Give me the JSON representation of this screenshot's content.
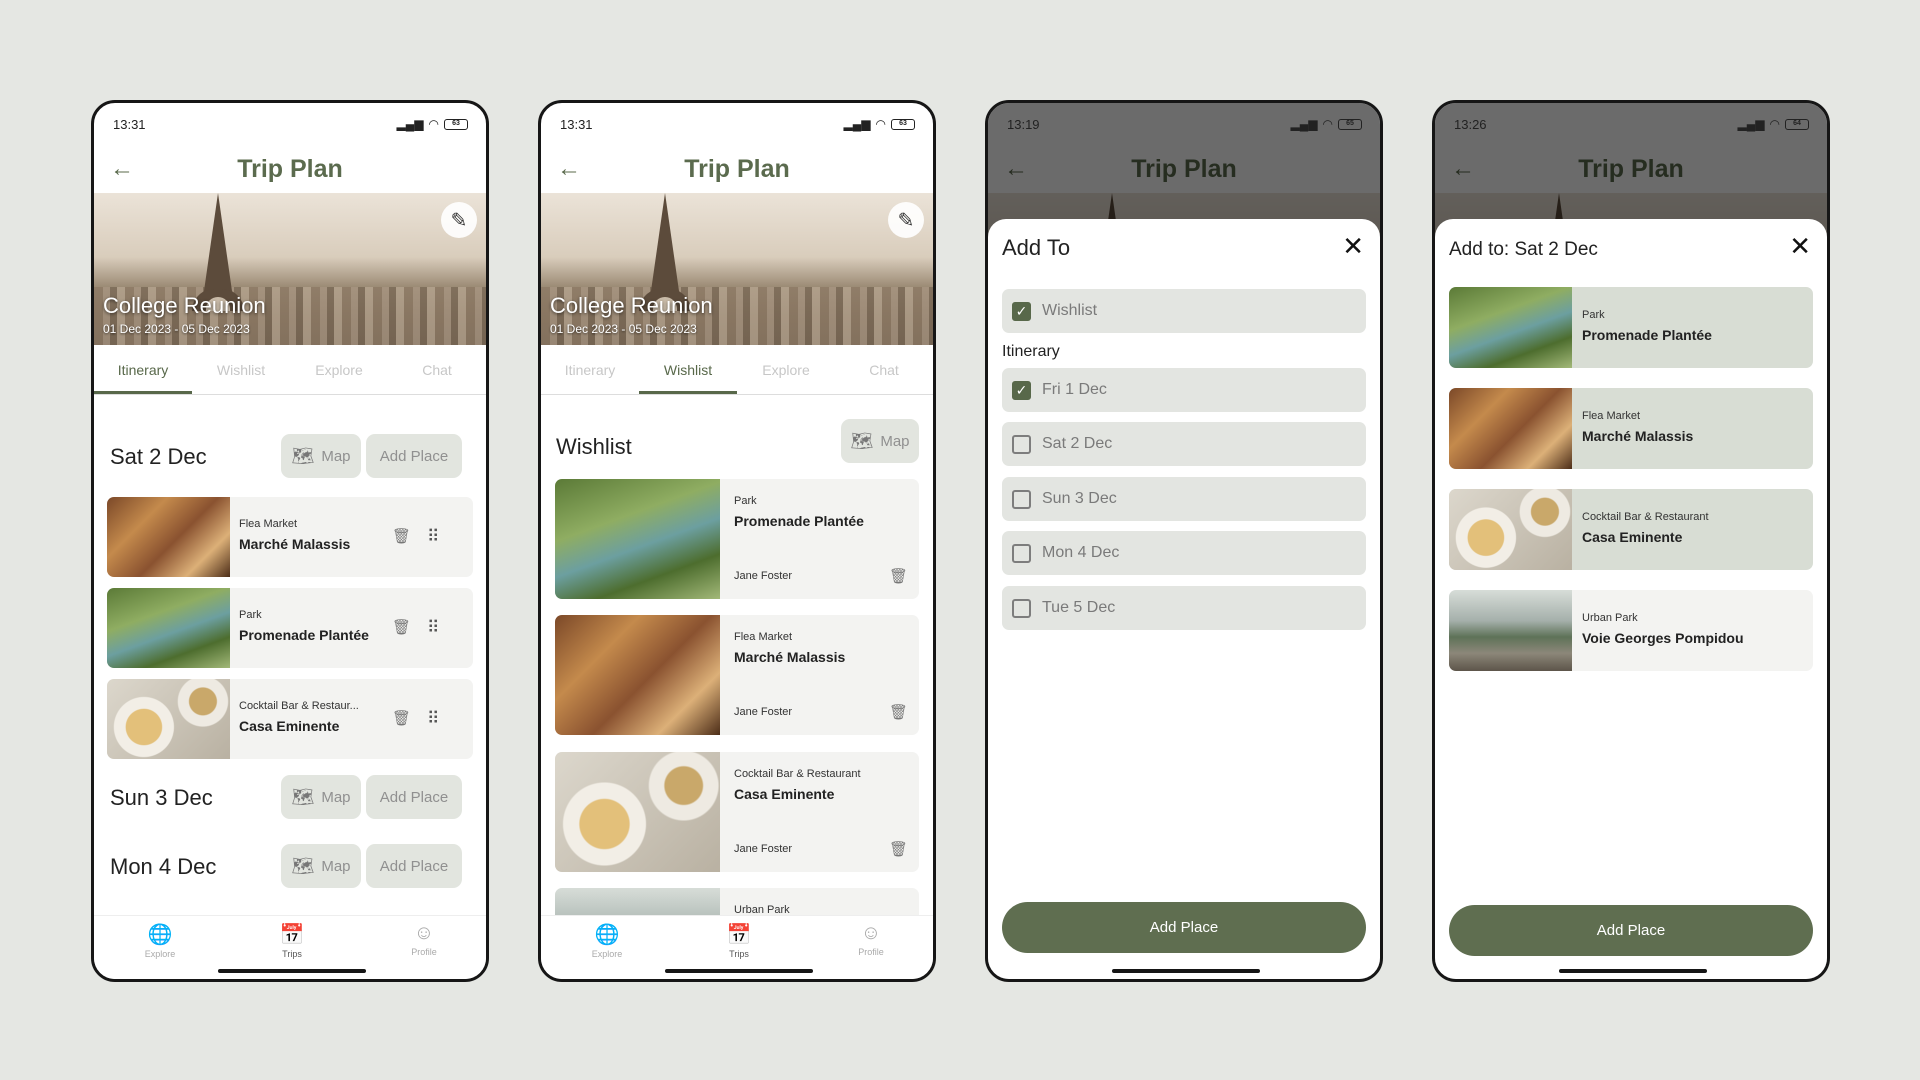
{
  "app": {
    "title": "Trip Plan"
  },
  "trip": {
    "name": "College Reunion",
    "dates": "01 Dec 2023 - 05 Dec 2023"
  },
  "tabs": [
    "Itinerary",
    "Wishlist",
    "Explore",
    "Chat"
  ],
  "bottom_nav": [
    "Explore",
    "Trips",
    "Profile"
  ],
  "icons": {
    "back": "arrow-left-icon",
    "edit": "pencil-icon",
    "map": "map-icon",
    "delete": "trash-icon",
    "drag": "drag-handle-icon",
    "close": "close-icon",
    "explore": "globe-icon",
    "trips": "calendar-icon",
    "profile": "user-circle-icon"
  },
  "colors": {
    "accent": "#58684a",
    "card": "#f3f3f1",
    "pill": "#e2e5df",
    "selected_card": "#d8ddd4",
    "background": "#e5e7e3"
  },
  "screens": [
    {
      "status": {
        "time": "13:31",
        "battery": "63"
      },
      "active_tab": "Itinerary",
      "days": [
        {
          "title": "Sat 2 Dec",
          "map_label": "Map",
          "add_label": "Add Place",
          "places": [
            {
              "category": "Flea Market",
              "name": "Marché Malassis"
            },
            {
              "category": "Park",
              "name": "Promenade Plantée"
            },
            {
              "category": "Cocktail Bar & Restaur...",
              "name": "Casa Eminente"
            }
          ]
        },
        {
          "title": "Sun 3 Dec",
          "map_label": "Map",
          "add_label": "Add Place"
        },
        {
          "title": "Mon 4 Dec",
          "map_label": "Map",
          "add_label": "Add Place"
        }
      ]
    },
    {
      "status": {
        "time": "13:31",
        "battery": "63"
      },
      "active_tab": "Wishlist",
      "section_title": "Wishlist",
      "map_label": "Map",
      "items": [
        {
          "category": "Park",
          "name": "Promenade Plantée",
          "owner": "Jane Foster"
        },
        {
          "category": "Flea Market",
          "name": "Marché Malassis",
          "owner": "Jane Foster"
        },
        {
          "category": "Cocktail Bar & Restaurant",
          "name": "Casa Eminente",
          "owner": "Jane Foster"
        },
        {
          "category": "Urban Park"
        }
      ]
    },
    {
      "status": {
        "time": "13:19",
        "battery": "65"
      },
      "sheet_title": "Add To",
      "wishlist_option": {
        "label": "Wishlist",
        "checked": true
      },
      "itinerary_label": "Itinerary",
      "options": [
        {
          "label": "Fri 1 Dec",
          "checked": true
        },
        {
          "label": "Sat 2 Dec",
          "checked": false
        },
        {
          "label": "Sun 3 Dec",
          "checked": false
        },
        {
          "label": "Mon 4 Dec",
          "checked": false
        },
        {
          "label": "Tue 5 Dec",
          "checked": false
        }
      ],
      "button": "Add Place"
    },
    {
      "status": {
        "time": "13:26",
        "battery": "64"
      },
      "sheet_title": "Add to: Sat 2 Dec",
      "places": [
        {
          "category": "Park",
          "name": "Promenade Plantée",
          "selected": true
        },
        {
          "category": "Flea Market",
          "name": "Marché Malassis",
          "selected": true
        },
        {
          "category": "Cocktail Bar & Restaurant",
          "name": "Casa Eminente",
          "selected": true
        },
        {
          "category": "Urban Park",
          "name": "Voie Georges Pompidou",
          "selected": false
        }
      ],
      "button": "Add Place"
    }
  ]
}
